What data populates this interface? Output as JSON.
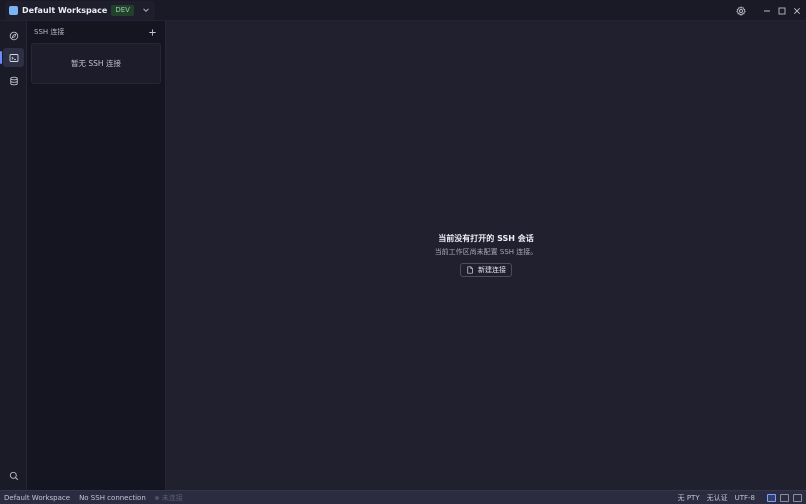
{
  "titlebar": {
    "workspace_name": "Default Workspace",
    "env_badge": "DEV",
    "icons": [
      "workspace-logo-icon",
      "chevron-down-icon",
      "gear-icon",
      "minimize-icon",
      "maximize-icon",
      "close-icon"
    ]
  },
  "activitybar": {
    "items": [
      {
        "name": "explore-icon",
        "active": false
      },
      {
        "name": "terminal-icon",
        "active": true
      },
      {
        "name": "database-icon",
        "active": false
      }
    ],
    "bottom": "search-icon"
  },
  "sidepanel": {
    "title": "SSH 连接",
    "add_icon": "plus-icon",
    "empty_text": "暂无 SSH 连接"
  },
  "main": {
    "empty_title": "当前没有打开的 SSH 会话",
    "empty_desc": "当前工作区尚未配置 SSH 连接。",
    "new_button_label": "新建连接"
  },
  "statusbar": {
    "workspace": "Default Workspace",
    "connection": "No SSH connection",
    "conn_state": "未连接",
    "pty": "无 PTY",
    "auth": "无认证",
    "encoding": "UTF-8"
  },
  "colors": {
    "accent": "#6b8cff",
    "badge_text": "#8fd19e",
    "background": "#20202f"
  }
}
